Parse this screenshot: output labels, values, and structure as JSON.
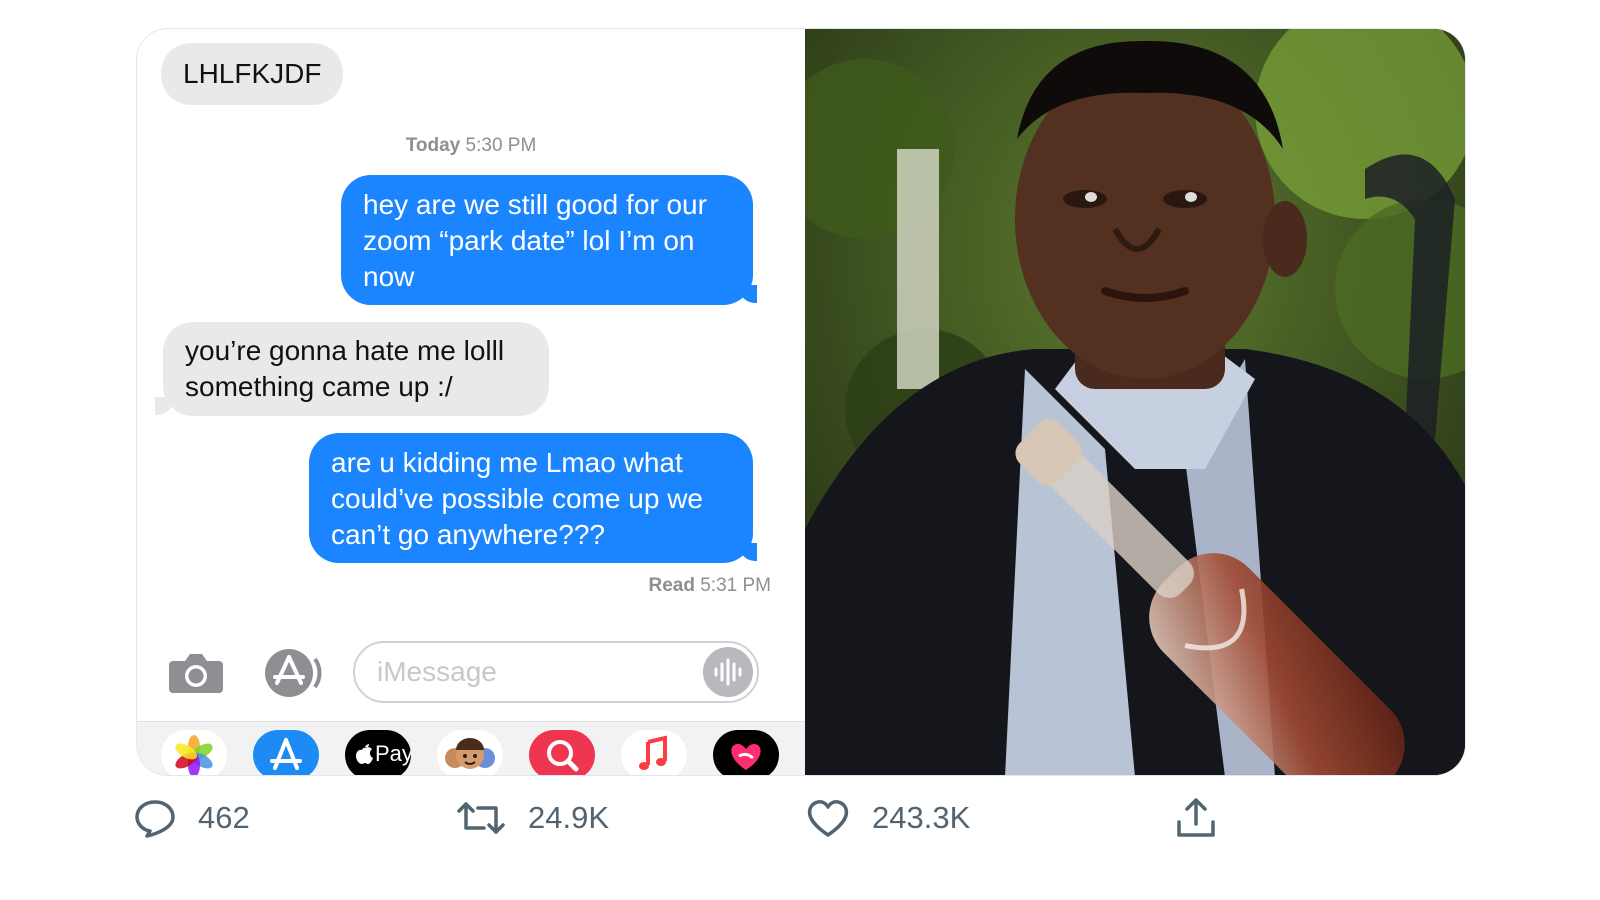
{
  "conversation": {
    "top_message": "LHLFKJDF",
    "timestamp": {
      "day": "Today",
      "time": "5:30 PM"
    },
    "messages": [
      {
        "direction": "out",
        "lines": [
          "hey are we still good for our",
          "zoom “park date” lol I’m on",
          "now"
        ]
      },
      {
        "direction": "in",
        "lines": [
          "you’re gonna hate me lolll",
          "something came up :/"
        ]
      },
      {
        "direction": "out",
        "lines": [
          "are u kidding me Lmao what",
          "could’ve possible come up we",
          "can’t go anywhere???"
        ]
      }
    ],
    "read_receipt": {
      "label": "Read",
      "time": "5:31 PM"
    }
  },
  "composer": {
    "placeholder": "iMessage"
  },
  "app_drawer": [
    {
      "name": "photos-app-icon"
    },
    {
      "name": "app-store-icon"
    },
    {
      "name": "apple-pay-icon",
      "label": "Pay"
    },
    {
      "name": "memoji-icon"
    },
    {
      "name": "image-search-icon"
    },
    {
      "name": "music-icon"
    },
    {
      "name": "digital-touch-icon"
    }
  ],
  "actions": {
    "replies": "462",
    "retweets": "24.9K",
    "likes": "243.3K"
  },
  "colors": {
    "sent_bubble": "#1a85ff",
    "received_bubble": "#e9e9eb",
    "action_icon": "#536471"
  }
}
